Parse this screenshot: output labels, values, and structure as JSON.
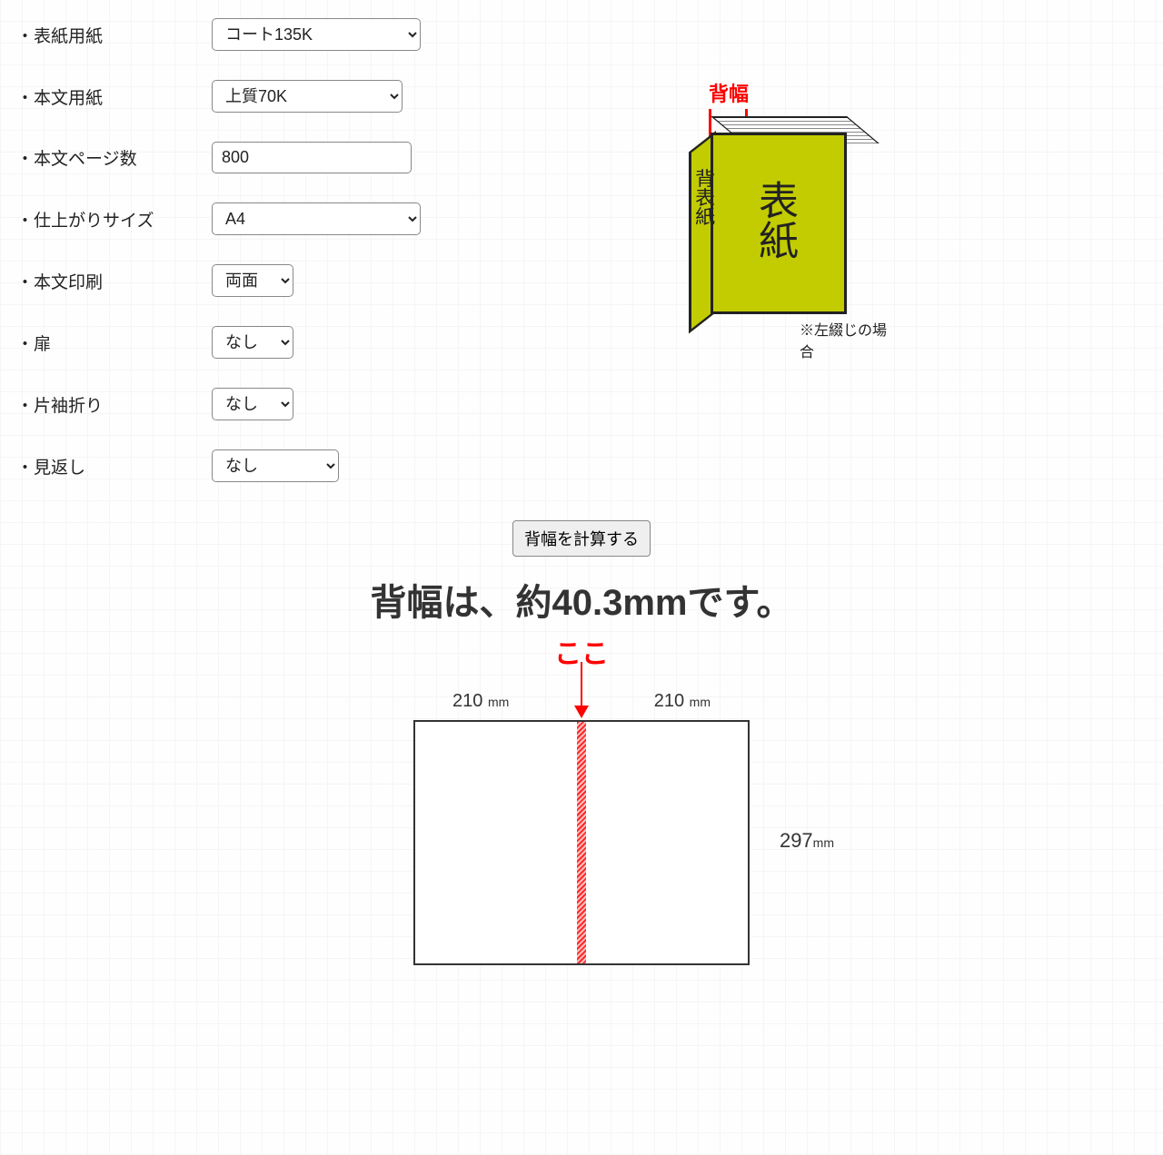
{
  "form": {
    "cover_paper": {
      "label": "表紙用紙",
      "value": "コート135K"
    },
    "body_paper": {
      "label": "本文用紙",
      "value": "上質70K"
    },
    "page_count": {
      "label": "本文ページ数",
      "value": "800"
    },
    "finish_size": {
      "label": "仕上がりサイズ",
      "value": "A4"
    },
    "body_print": {
      "label": "本文印刷",
      "value": "両面"
    },
    "tobira": {
      "label": "扉",
      "value": "なし"
    },
    "sleeve_fold": {
      "label": "片袖折り",
      "value": "なし"
    },
    "mikaeshi": {
      "label": "見返し",
      "value": "なし"
    }
  },
  "calc_button": "背幅を計算する",
  "result_text": "背幅は、約40.3mmです。",
  "book": {
    "sehaba_label": "背幅",
    "front_text": "表紙",
    "spine_text": "背表紙",
    "note": "※左綴じの場合"
  },
  "flat": {
    "koko": "ここ",
    "width1": "210",
    "width2": "210",
    "height": "297",
    "mm": "mm"
  }
}
